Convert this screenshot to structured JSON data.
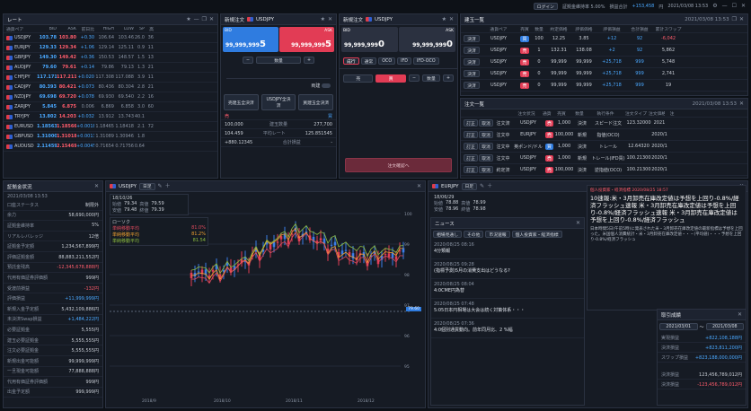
{
  "topbar": {
    "status": "ログイン",
    "acct": "証拠金維持率 5.00%",
    "pl": "損益合計",
    "total": "+153,458",
    "user": "円",
    "time": "2021/03/08 13:53"
  },
  "rate": {
    "title": "レート",
    "cols": [
      "通貨ペア",
      "BID",
      "ASK",
      "前日比",
      "HIGH",
      "LOW",
      "SP",
      "高"
    ],
    "rows": [
      [
        "USDJPY",
        "103.78",
        "103.80",
        "+0.30",
        "106.64",
        "103.46",
        "26.0",
        "36"
      ],
      [
        "EURJPY",
        "129.33",
        "129.34",
        "+1.06",
        "129.14",
        "125.11",
        "0.9",
        "11"
      ],
      [
        "GBPJPY",
        "149.30",
        "149.42",
        "+0.36",
        "150.53",
        "148.57",
        "1.5",
        "13"
      ],
      [
        "AUDJPY",
        "79.60",
        "79.61",
        "+0.14",
        "79.86",
        "79.13",
        "1.3",
        "21"
      ],
      [
        "CHFJPY",
        "117.171",
        "117.211",
        "+0.020",
        "117.308",
        "117.088",
        "3.9",
        "11"
      ],
      [
        "CADJPY",
        "80.393",
        "80.421",
        "+0.073",
        "80.436",
        "80.304",
        "2.8",
        "21"
      ],
      [
        "NZDJPY",
        "69.698",
        "69.720",
        "+0.078",
        "69.930",
        "69.540",
        "2.2",
        "16"
      ],
      [
        "ZARJPY",
        "5.845",
        "6.875",
        "0.006",
        "6.869",
        "6.858",
        "3.0",
        "60"
      ],
      [
        "TRYJPY",
        "13.802",
        "14.203",
        "+0.032",
        "13.912",
        "13.743",
        "40.1",
        ""
      ],
      [
        "EURUSD",
        "1.18563",
        "1.18566",
        "+0.00184",
        "1.18465",
        "1.18418",
        "2.1",
        "72"
      ],
      [
        "GBPUSD",
        "1.31000",
        "1.31018",
        "+0.00131",
        "1.31089",
        "1.30946",
        "1.8",
        ""
      ],
      [
        "AUDUSD",
        "2.11459",
        "2.15469",
        "+0.00453",
        "0.71654",
        "0.71756",
        "0.64",
        ""
      ]
    ]
  },
  "qo1": {
    "title": "新規注文",
    "pair": "USDJPY",
    "bid": "99,999,999",
    "bid_s": "5",
    "ask": "99,999,999",
    "ask_s": "5",
    "bidl": "BID",
    "askl": "ASK",
    "qty_label": "数量",
    "mode": "両建",
    "btns": [
      "売建玉全決済",
      "USDJPY全決済",
      "買建玉全決済"
    ],
    "sum_h": [
      "売",
      "",
      "買"
    ],
    "sum": [
      [
        "100,000",
        "建玉数量",
        "277,700"
      ],
      [
        "104.459",
        "平均レート",
        "125.851545"
      ],
      [
        "+880.12345",
        "合計損益",
        "-"
      ]
    ]
  },
  "qo2": {
    "title": "新規注文",
    "pair": "USDJPY",
    "bid": "99,999,999",
    "bid_s": "0",
    "ask": "99,999,999",
    "ask_s": "0",
    "bidl": "BID",
    "askl": "ASK",
    "tabs": [
      "成行",
      "通常",
      "OCO",
      "IFD",
      "IFD-OCO"
    ],
    "side": [
      "売",
      "買"
    ],
    "qty": "数量",
    "confirm": "注文確認へ"
  },
  "pos": {
    "title": "建玉一覧",
    "time": "2021/03/08 13:53",
    "cols": [
      "",
      "通貨ペア",
      "売買",
      "数量",
      "約定価格",
      "評価価格",
      "評価損益",
      "合計損益",
      "累計スワップ"
    ],
    "rows": [
      [
        "決済",
        "USDJPY",
        "買",
        "100",
        "12.25",
        "3.85",
        "+12",
        "92",
        "-6,042"
      ],
      [
        "決済",
        "USDJPY",
        "売",
        "1",
        "132.31",
        "138.08",
        "+2",
        "92",
        "5,862"
      ],
      [
        "決済",
        "USDJPY",
        "売",
        "0",
        "99,999",
        "99,999",
        "+25,718",
        "999",
        "5,748"
      ],
      [
        "決済",
        "USDJPY",
        "売",
        "0",
        "99,999",
        "99,999",
        "+25,718",
        "999",
        "2,741"
      ],
      [
        "決済",
        "USDJPY",
        "売",
        "0",
        "99,999",
        "99,999",
        "+25,718",
        "999",
        "19"
      ]
    ]
  },
  "orders": {
    "title": "注文一覧",
    "time": "2021/03/08 13:53",
    "cols": [
      "",
      "",
      "",
      "注文状況",
      "通貨ペア",
      "売買",
      "数量",
      "執行条件",
      "注文タイプ",
      "注文価格",
      "注"
    ],
    "rows": [
      [
        "訂正",
        "取消",
        "注文済",
        "USDJPY",
        "売",
        "1,000",
        "決済",
        "スピード注文",
        "123.32000",
        "2021"
      ],
      [
        "訂正",
        "取消",
        "注文中",
        "EURJPY",
        "売",
        "100,000",
        "新規",
        "指値(OCO)",
        "",
        "2020/1"
      ],
      [
        "訂正",
        "取消",
        "注文中",
        "英ポンド/ドル",
        "買",
        "1,000",
        "決済",
        "トレール",
        "12.64320",
        "2020/1"
      ],
      [
        "訂正",
        "取消",
        "注文中",
        "USDJPY",
        "売",
        "1,000",
        "新規",
        "トレール(IFD買)",
        "100.21300",
        "2020/1"
      ],
      [
        "訂正",
        "取消",
        "約定済",
        "USDJPY",
        "売",
        "100,000",
        "決済",
        "逆指値(OCO)",
        "100.21300",
        "2020/1"
      ]
    ]
  },
  "margin": {
    "title": "証拠金状況",
    "time": "2021/03/08 13:53",
    "rows": [
      [
        "口座ステータス",
        "制限外"
      ],
      [
        "余力",
        "58,690,000円"
      ],
      [
        "証拠金維持率",
        "5%"
      ],
      [
        "リアルレバレッジ",
        "12倍"
      ],
      [
        "証拠金予定額",
        "1,234,567,899円"
      ],
      [
        "評価証拠金額",
        "88,883,211,552円"
      ],
      [
        "預託金残高",
        "-12,345,678,888円"
      ],
      [
        "代用有価証券評価額",
        "999円"
      ],
      [
        "受渡前損益",
        "-132円"
      ],
      [
        "評価損益",
        "+11,999,999円"
      ],
      [
        "新規入金予定額",
        "5,432,109,886円"
      ],
      [
        "未決済Swap損益",
        "+1,484,222円"
      ],
      [
        "必要証拠金",
        "5,555円"
      ],
      [
        "建玉必要証拠金",
        "5,555,555円"
      ],
      [
        "注文必要証拠金",
        "5,555,555円"
      ],
      [
        "新規出金可能額",
        "99,999,999円"
      ],
      [
        "一旦現金可能額",
        "77,888,888円"
      ],
      [
        "代用有価証券評価額",
        "999円"
      ],
      [
        "出金予定額",
        "999,999円"
      ]
    ]
  },
  "chart1": {
    "pair": "USDJPY",
    "tf": "日足",
    "date": "18/10/26",
    "o": "79.34",
    "h": "79.59",
    "l": "79.48",
    "c": "79.39",
    "ol": "始値",
    "hl": "高値",
    "ll": "安値",
    "cl": "終値",
    "legend": "ローソク",
    "ma": [
      "単純移動平均",
      "単純移動平均",
      "単純移動平均"
    ],
    "mav": [
      "81.0%",
      "81.2%",
      "81.54"
    ],
    "price_tag": "79.60",
    "yticks": [
      "100",
      "99",
      "98",
      "97",
      "96",
      "95"
    ],
    "xticks": [
      "2018/9",
      "2018/10",
      "2018/11",
      "2018/12"
    ]
  },
  "chart2": {
    "pair": "EURJPY",
    "tf": "日足",
    "date": "18/06/29",
    "o": "78.88",
    "h": "78.99",
    "l": "78.96",
    "c": "78.98",
    "ol": "始値",
    "hl": "高値",
    "ll": "安値",
    "cl": "終値"
  },
  "news": {
    "title": "ニュース",
    "filters": [
      "相場見通し",
      "その他",
      "市況速報",
      "個人投資家・経済指標"
    ],
    "items": [
      [
        "2020/08/25 08:16",
        "4分類報"
      ],
      [
        "2020/08/25 09:28",
        "(指標予測)5月の消費支出はどうなる?"
      ],
      [
        "2020/08/25 08:04",
        "4:0CME円為替"
      ],
      [
        "2020/08/25 07:48",
        "5:05日本円相場は大会は続く対策体系・・・"
      ],
      [
        "2020/08/25 07:36",
        "4:0個別通貨動向。前年同月比、2 %幅"
      ]
    ],
    "detail_head": "個人投資家・経済指標 2020/08/25 18:57",
    "headline": "10速報:米・3月卸売在庫改定値は予想を上回り-0.8%/経済フラッシュ速報 米・3月卸売在庫改定値は予想を上回り-0.8%/経済フラッシュ速報 米・3月卸売在庫改定値は予想を上回り-0.8%/経済フラッシュ",
    "body": "日本時間5日(午前5時)に発表された米・3月卸売在庫改定値の最新指標は予想を上回った。米国個人消費統計・米・3月卸売在庫改定値・・・(平均値)・・・予想を上回り-0.8%/経済フラッシュ"
  },
  "trade": {
    "title": "取引成績",
    "from": "2021/03/01",
    "to": "2021/03/08",
    "sep": "〜",
    "rows": [
      [
        "実現損益",
        "+822,108,188円"
      ],
      [
        "決済損益",
        "+823,811,200円"
      ],
      [
        "スワップ損益",
        "+823,188,000,000円"
      ],
      [
        "決済損益",
        "123,456,789,012円"
      ],
      [
        "決済損益",
        "-123,456,789,012円"
      ]
    ]
  }
}
